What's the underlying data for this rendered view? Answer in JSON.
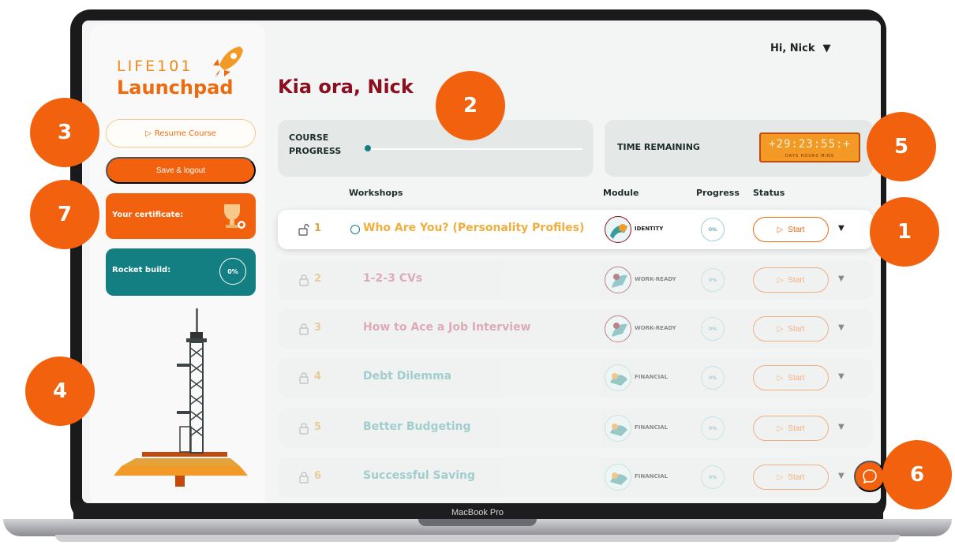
{
  "device": {
    "label": "MacBook Pro"
  },
  "sidebar": {
    "logo_top": "LIFE101",
    "logo_bottom": "Launchpad",
    "resume_label": "Resume Course",
    "logout_label": "Save & logout",
    "certificate_label": "Your certificate:",
    "rocket_label": "Rocket build:",
    "rocket_progress": "0%"
  },
  "header": {
    "user_greeting": "Hi, Nick"
  },
  "main": {
    "greeting": "Kia ora, Nick",
    "course_progress_label": "COURSE PROGRESS",
    "course_progress_value": 0,
    "time_remaining_label": "TIME REMAINING",
    "timer": {
      "digits": "+29:23:55:+",
      "units": "DAYS  HOURS  MINS"
    }
  },
  "table": {
    "columns": {
      "workshops": "Workshops",
      "module": "Module",
      "progress": "Progress",
      "status": "Status"
    },
    "rows": [
      {
        "num": "1",
        "title": "Who Are You? (Personality Profiles)",
        "module": "IDENTITY",
        "progress": "0%",
        "status": "Start"
      },
      {
        "num": "2",
        "title": "1-2-3 CVs",
        "module": "WORK-READY",
        "progress": "0%",
        "status": "Start"
      },
      {
        "num": "3",
        "title": "How to Ace a Job Interview",
        "module": "WORK-READY",
        "progress": "0%",
        "status": "Start"
      },
      {
        "num": "4",
        "title": "Debt Dilemma",
        "module": "FINANCIAL",
        "progress": "0%",
        "status": "Start"
      },
      {
        "num": "5",
        "title": "Better Budgeting",
        "module": "FINANCIAL",
        "progress": "0%",
        "status": "Start"
      },
      {
        "num": "6",
        "title": "Successful Saving",
        "module": "FINANCIAL",
        "progress": "0%",
        "status": "Start"
      }
    ]
  },
  "callouts": [
    "1",
    "2",
    "3",
    "4",
    "5",
    "6",
    "7"
  ],
  "colors": {
    "primary": "#f2610d",
    "teal": "#137f82",
    "maroon": "#8a1020",
    "gold": "#e3a33a"
  }
}
